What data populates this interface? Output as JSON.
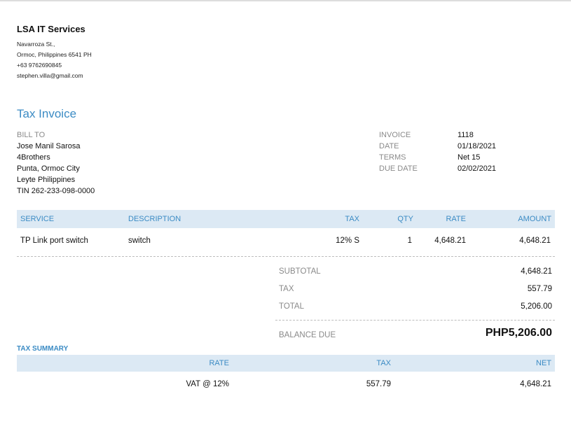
{
  "company": {
    "name": "LSA IT Services",
    "address1": "Navarroza St.,",
    "address2": "Ormoc, Philippines  6541 PH",
    "phone": "+63 9762690845",
    "email": "stephen.villa@gmail.com"
  },
  "doc_title": "Tax Invoice",
  "bill_to": {
    "label": "BILL TO",
    "lines": [
      "Jose Manil Sarosa",
      "4Brothers",
      "Punta, Ormoc City",
      "Leyte Philippines",
      "TIN 262-233-098-0000"
    ]
  },
  "meta": [
    {
      "label": "INVOICE",
      "value": "1118"
    },
    {
      "label": "DATE",
      "value": "01/18/2021"
    },
    {
      "label": "TERMS",
      "value": "Net 15"
    },
    {
      "label": "DUE DATE",
      "value": "02/02/2021"
    }
  ],
  "items": {
    "headers": {
      "service": "SERVICE",
      "description": "DESCRIPTION",
      "tax": "TAX",
      "qty": "QTY",
      "rate": "RATE",
      "amount": "AMOUNT"
    },
    "rows": [
      {
        "service": "TP Link port switch",
        "description": "switch",
        "tax": "12% S",
        "qty": "1",
        "rate": "4,648.21",
        "amount": "4,648.21"
      }
    ]
  },
  "totals": {
    "subtotal_label": "SUBTOTAL",
    "subtotal": "4,648.21",
    "tax_label": "TAX",
    "tax": "557.79",
    "total_label": "TOTAL",
    "total": "5,206.00",
    "balance_label": "BALANCE DUE",
    "balance": "PHP5,206.00"
  },
  "tax_summary": {
    "title": "TAX SUMMARY",
    "headers": {
      "rate": "RATE",
      "tax": "TAX",
      "net": "NET"
    },
    "rows": [
      {
        "rate": "VAT @ 12%",
        "tax": "557.79",
        "net": "4,648.21"
      }
    ]
  }
}
